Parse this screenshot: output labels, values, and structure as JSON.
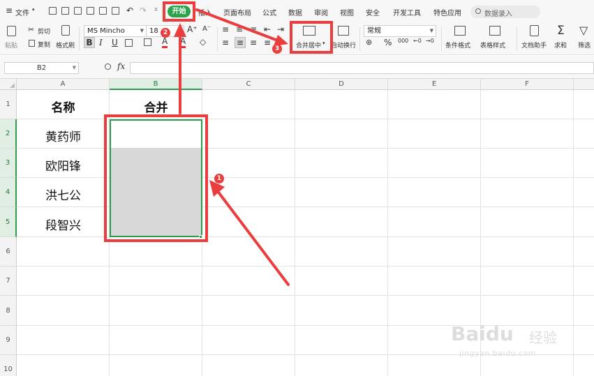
{
  "menu": {
    "file_label": "文件",
    "tabs": [
      "开始",
      "插入",
      "页面布局",
      "公式",
      "数据",
      "审阅",
      "视图",
      "安全",
      "开发工具",
      "特色应用"
    ],
    "search_placeholder": "数据录入"
  },
  "ribbon": {
    "paste_label": "粘贴",
    "cut_label": "剪切",
    "copy_label": "复制",
    "format_painter_label": "格式刷",
    "font_name": "MS Mincho",
    "font_size": "18",
    "merge_center_label": "合并居中",
    "wrap_text_label": "自动换行",
    "number_format": "常规",
    "percent_symbol": "%",
    "conditional_format_label": "条件格式",
    "table_style_label": "表格样式",
    "doc_assistant_label": "文档助手",
    "sum_label": "求和",
    "filter_label": "筛选"
  },
  "formula_bar": {
    "cell_ref": "B2",
    "fx_label": "fx",
    "value": ""
  },
  "grid": {
    "columns": [
      "A",
      "B",
      "C",
      "D",
      "E",
      "F"
    ],
    "rows": [
      "1",
      "2",
      "3",
      "4",
      "5",
      "6",
      "7",
      "8",
      "9",
      "10"
    ],
    "header_a1": "名称",
    "header_b1": "合并",
    "names": [
      "黄药师",
      "欧阳锋",
      "洪七公",
      "段智兴"
    ],
    "selected_range": "B2:B5"
  },
  "annotations": {
    "steps": [
      "1",
      "2",
      "3"
    ]
  },
  "watermark": {
    "brand": "Baidu",
    "suffix": "经验",
    "url": "jingyan.baidu.com"
  },
  "colors": {
    "accent": "#2aa34a",
    "selection_border": "#2e9a4c",
    "annotation_red": "#ea3d3d",
    "selection_fill": "#d8d8d8"
  }
}
